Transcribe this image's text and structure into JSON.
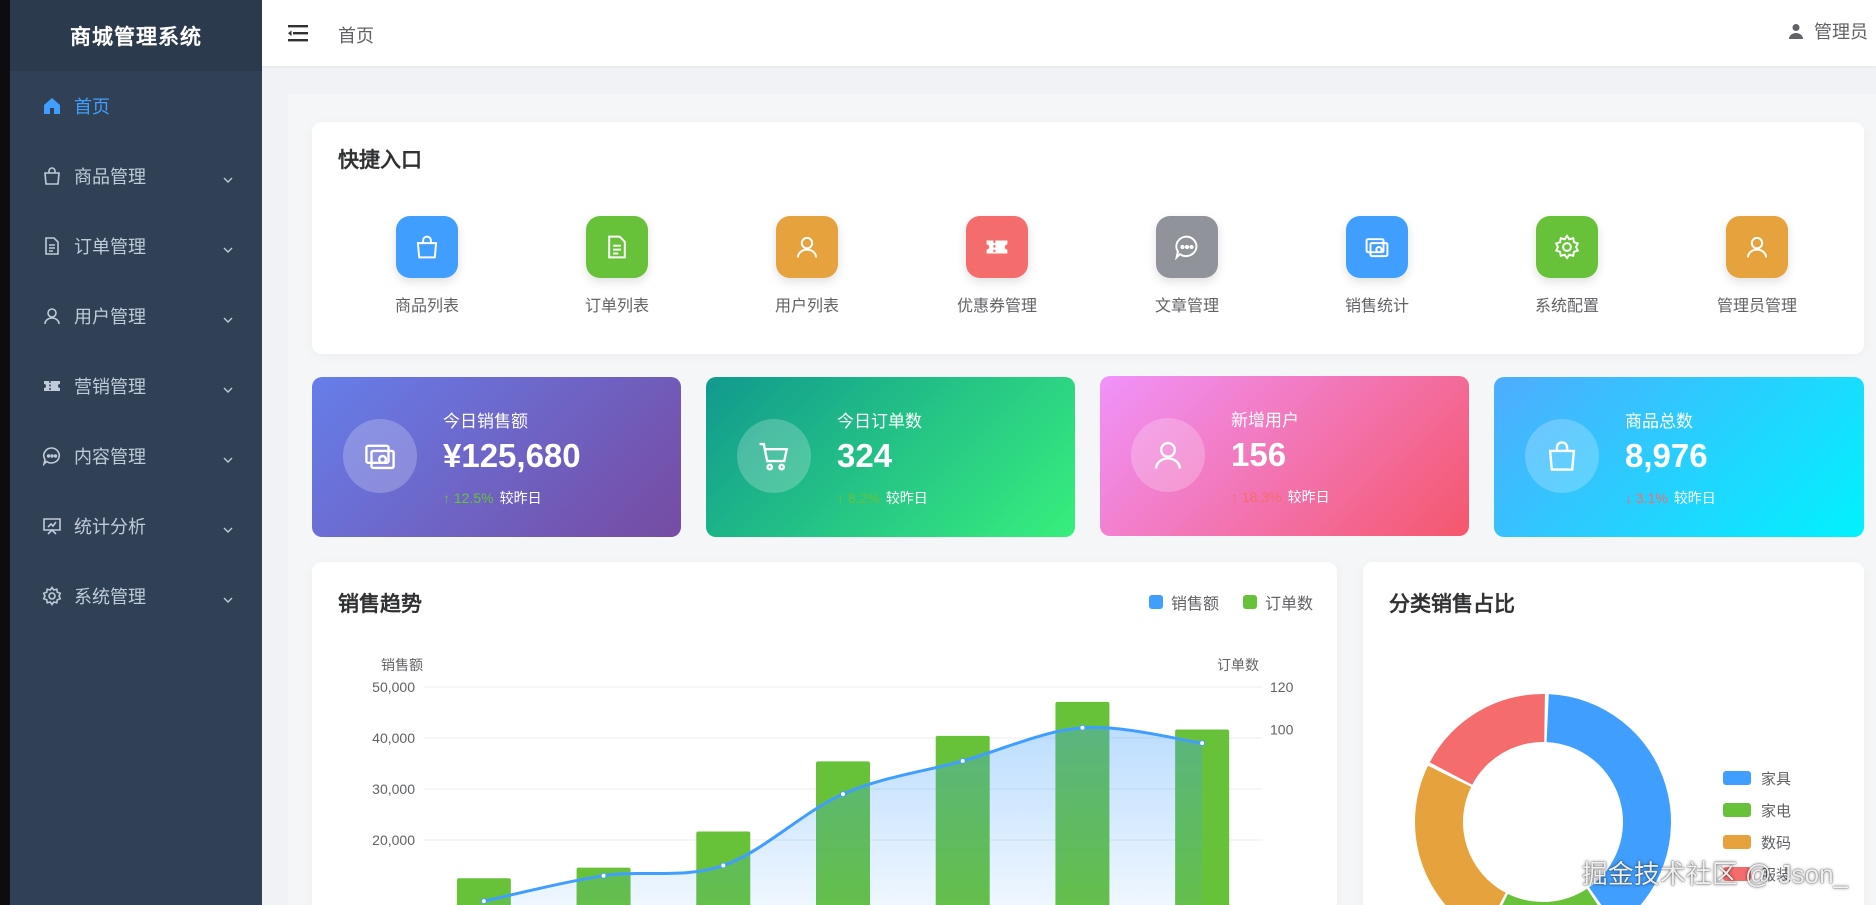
{
  "app": {
    "title": "商城管理系统"
  },
  "sidebar": {
    "items": [
      {
        "label": "首页",
        "icon": "home-icon",
        "active": true
      },
      {
        "label": "商品管理",
        "icon": "bag-icon"
      },
      {
        "label": "订单管理",
        "icon": "document-icon"
      },
      {
        "label": "用户管理",
        "icon": "user-icon"
      },
      {
        "label": "营销管理",
        "icon": "ticket-icon"
      },
      {
        "label": "内容管理",
        "icon": "chat-icon"
      },
      {
        "label": "统计分析",
        "icon": "presentation-icon"
      },
      {
        "label": "系统管理",
        "icon": "gear-icon"
      }
    ]
  },
  "header": {
    "breadcrumb": "首页",
    "user": "管理员"
  },
  "quick_entry": {
    "title": "快捷入口",
    "items": [
      {
        "label": "商品列表",
        "icon": "bag-icon",
        "color": "#409eff"
      },
      {
        "label": "订单列表",
        "icon": "document-icon",
        "color": "#67c23a"
      },
      {
        "label": "用户列表",
        "icon": "user-icon",
        "color": "#e6a23c"
      },
      {
        "label": "优惠券管理",
        "icon": "ticket-icon",
        "color": "#f56c6c"
      },
      {
        "label": "文章管理",
        "icon": "chat-icon",
        "color": "#909399"
      },
      {
        "label": "销售统计",
        "icon": "money-icon",
        "color": "#409eff"
      },
      {
        "label": "系统配置",
        "icon": "gear-icon",
        "color": "#67c23a"
      },
      {
        "label": "管理员管理",
        "icon": "user-icon",
        "color": "#e6a23c"
      }
    ]
  },
  "stats": [
    {
      "title": "今日销售额",
      "value": "¥125,680",
      "change": "↑ 12.5%",
      "compare": "较昨日",
      "icon": "money-icon",
      "gradient": [
        "#667eea",
        "#764ba2"
      ],
      "change_color": "#67c23a"
    },
    {
      "title": "今日订单数",
      "value": "324",
      "change": "↑ 8.2%",
      "compare": "较昨日",
      "icon": "cart-icon",
      "gradient": [
        "#11998e",
        "#38ef7d"
      ],
      "change_color": "#67c23a"
    },
    {
      "title": "新增用户",
      "value": "156",
      "change": "↑ 18.3%",
      "compare": "较昨日",
      "icon": "user-icon",
      "gradient": [
        "#f093fb",
        "#f5576c"
      ],
      "change_color": "#f56c6c"
    },
    {
      "title": "商品总数",
      "value": "8,976",
      "change": "↓ 3.1%",
      "compare": "较昨日",
      "icon": "bag-icon",
      "gradient": [
        "#4facfe",
        "#00f2fe"
      ],
      "change_color": "#f56c6c"
    }
  ],
  "trend": {
    "title": "销售趋势",
    "legend": [
      {
        "name": "销售额",
        "color": "#409eff"
      },
      {
        "name": "订单数",
        "color": "#67c23a"
      }
    ]
  },
  "category": {
    "title": "分类销售占比",
    "legend": [
      {
        "name": "家具",
        "color": "#409eff"
      },
      {
        "name": "家电",
        "color": "#67c23a"
      },
      {
        "name": "数码",
        "color": "#e6a23c"
      },
      {
        "name": "服装",
        "color": "#f56c6c"
      }
    ]
  },
  "chart_data": [
    {
      "type": "line",
      "title": "销售趋势",
      "ylabel": "销售额",
      "y2label": "订单数",
      "ylim": [
        0,
        50000
      ],
      "y2lim": [
        0,
        120
      ],
      "yticks": [
        "50,000",
        "40,000",
        "30,000",
        "20,000"
      ],
      "y2ticks": [
        "120",
        "100"
      ],
      "series": [
        {
          "name": "销售额",
          "kind": "line-area",
          "values": [
            8000,
            13000,
            15000,
            29000,
            35500,
            42000,
            39000
          ]
        },
        {
          "name": "订单数",
          "kind": "bar",
          "axis": "y2",
          "values": [
            30,
            35,
            52,
            85,
            97,
            113,
            100
          ]
        }
      ]
    },
    {
      "type": "pie",
      "title": "分类销售占比",
      "labels": [
        "家具",
        "家电",
        "数码",
        "服装"
      ],
      "values": [
        40,
        17,
        25,
        18
      ]
    }
  ],
  "watermark": "掘金技术社区 @ Json_"
}
